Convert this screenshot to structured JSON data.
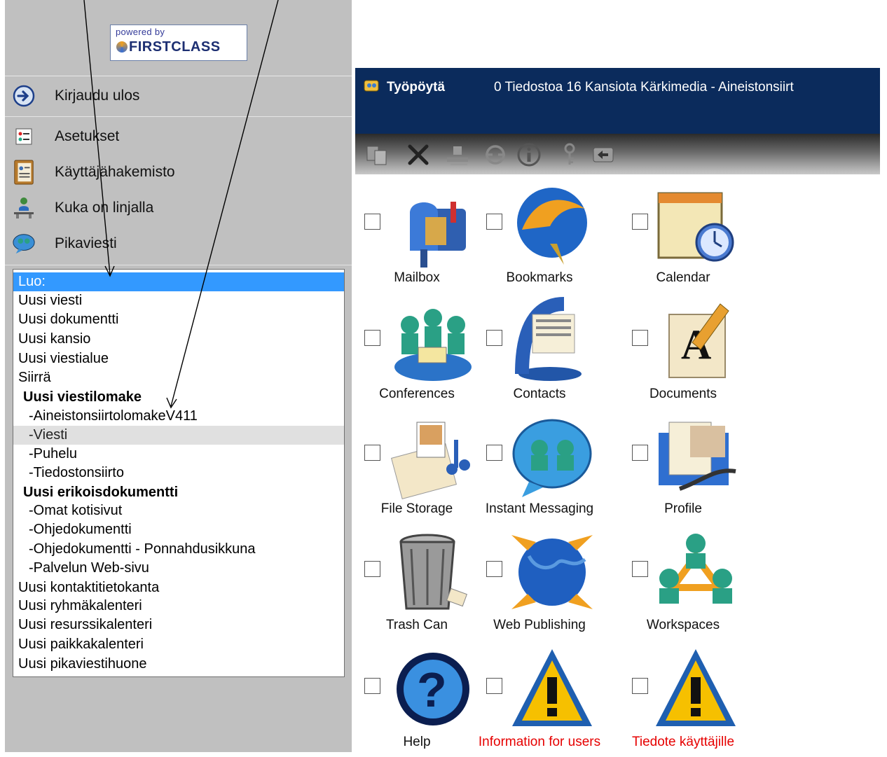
{
  "brand": {
    "powered_by": "powered by",
    "name": "FirstClass"
  },
  "sidebar": {
    "items": [
      {
        "label": "Kirjaudu ulos",
        "icon": "logout-icon"
      },
      {
        "label": "Asetukset",
        "icon": "settings-icon"
      },
      {
        "label": "Käyttäjähakemisto",
        "icon": "directory-icon"
      },
      {
        "label": "Kuka on linjalla",
        "icon": "who-is-online-icon"
      },
      {
        "label": "Pikaviesti",
        "icon": "instant-message-icon"
      }
    ]
  },
  "create_menu": {
    "selected_index": 0,
    "hover_index": 8,
    "options": [
      "Luo:",
      "Uusi viesti",
      "Uusi dokumentti",
      "Uusi kansio",
      "Uusi viestialue",
      "Siirrä",
      " Uusi viestilomake",
      "  -AineistonsiirtolomakeV411",
      "  -Viesti",
      "  -Puhelu",
      "  -Tiedostonsiirto",
      " Uusi erikoisdokumentti",
      "  -Omat kotisivut",
      "  -Ohjedokumentti",
      "  -Ohjedokumentti - Ponnahdusikkuna",
      "  -Palvelun Web-sivu",
      "Uusi kontaktitietokanta",
      "Uusi ryhmäkalenteri",
      "Uusi resurssikalenteri",
      "Uusi paikkakalenteri",
      "Uusi pikaviestihuone"
    ],
    "header_indices": [
      6,
      11
    ]
  },
  "desktop": {
    "title": "Työpöytä",
    "status": "0 Tiedostoa  16 Kansiota  Kärkimedia - Aineistonsiirt",
    "toolbar": [
      "copy-icon",
      "delete-icon",
      "upload-icon",
      "sync-icon",
      "info-icon",
      "key-icon",
      "reply-icon"
    ],
    "items": [
      {
        "label": "Mailbox",
        "icon": "mailbox-icon"
      },
      {
        "label": "Bookmarks",
        "icon": "bookmarks-icon"
      },
      {
        "label": "Calendar",
        "icon": "calendar-icon"
      },
      {
        "label": "Conferences",
        "icon": "conferences-icon"
      },
      {
        "label": "Contacts",
        "icon": "contacts-icon"
      },
      {
        "label": "Documents",
        "icon": "documents-icon"
      },
      {
        "label": "File Storage",
        "icon": "file-storage-icon"
      },
      {
        "label": "Instant Messaging",
        "icon": "instant-messaging-icon"
      },
      {
        "label": "Profile",
        "icon": "profile-icon"
      },
      {
        "label": "Trash Can",
        "icon": "trash-can-icon"
      },
      {
        "label": "Web Publishing",
        "icon": "web-publishing-icon"
      },
      {
        "label": "Workspaces",
        "icon": "workspaces-icon"
      },
      {
        "label": "Help",
        "icon": "help-icon"
      },
      {
        "label": "Information for users",
        "icon": "warning-icon",
        "color": "#e60000"
      },
      {
        "label": "Tiedote käyttäjille",
        "icon": "warning-icon",
        "color": "#e60000"
      }
    ]
  },
  "colors": {
    "titlebar": "#0b2b5c",
    "selection": "#3399ff",
    "sidebar": "#c0c0c0",
    "alert_text": "#e60000"
  }
}
